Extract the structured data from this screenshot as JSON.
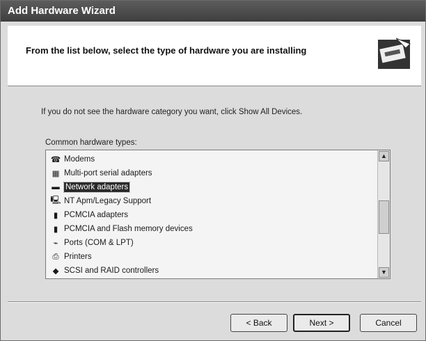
{
  "window": {
    "title": "Add Hardware Wizard"
  },
  "header": {
    "title": "From the list below, select the type of hardware you are installing"
  },
  "hint": "If you do not see the hardware category you want, click Show All Devices.",
  "list": {
    "label": "Common hardware types:",
    "items": [
      {
        "label": "Modems",
        "icon": "modem-icon"
      },
      {
        "label": "Multi-port serial adapters",
        "icon": "serial-adapter-icon"
      },
      {
        "label": "Network adapters",
        "icon": "network-adapter-icon",
        "selected": true
      },
      {
        "label": "NT Apm/Legacy Support",
        "icon": "computer-icon"
      },
      {
        "label": "PCMCIA adapters",
        "icon": "pcmcia-icon"
      },
      {
        "label": "PCMCIA and Flash memory devices",
        "icon": "flash-memory-icon"
      },
      {
        "label": "Ports (COM & LPT)",
        "icon": "port-icon"
      },
      {
        "label": "Printers",
        "icon": "printer-icon"
      },
      {
        "label": "SCSI and RAID controllers",
        "icon": "scsi-icon"
      }
    ]
  },
  "buttons": {
    "back": "< Back",
    "next": "Next >",
    "cancel": "Cancel"
  }
}
